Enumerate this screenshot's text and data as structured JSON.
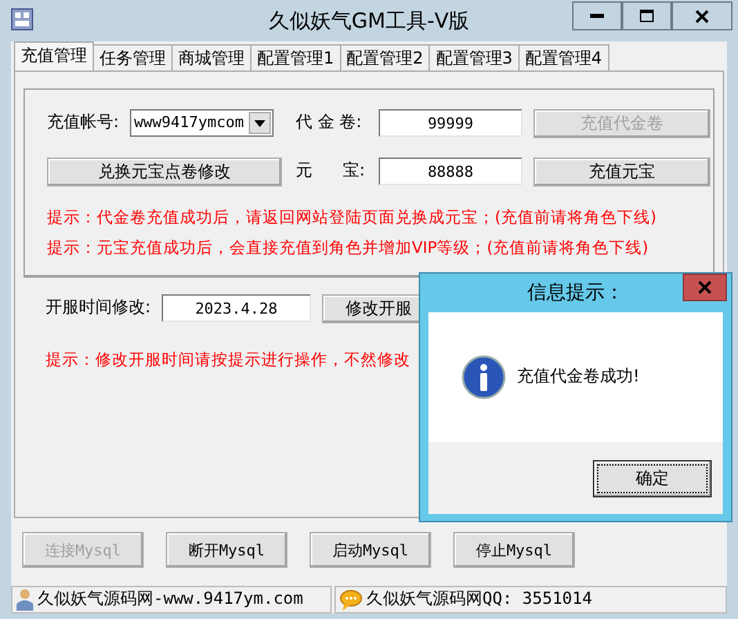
{
  "window": {
    "title": "久似妖气GM工具-V版"
  },
  "tabs": [
    {
      "label": "充值管理",
      "selected": true
    },
    {
      "label": "任务管理",
      "selected": false
    },
    {
      "label": "商城管理",
      "selected": false
    },
    {
      "label": "配置管理1",
      "selected": false
    },
    {
      "label": "配置管理2",
      "selected": false
    },
    {
      "label": "配置管理3",
      "selected": false
    },
    {
      "label": "配置管理4",
      "selected": false
    }
  ],
  "recharge": {
    "account_label": "充值帐号:",
    "account_value": "www9417ymcom",
    "voucher_label": "代 金 卷:",
    "voucher_value": "99999",
    "voucher_button": {
      "label": "充值代金卷",
      "disabled": true
    },
    "exchange_button": {
      "label": "兑换元宝点卷修改",
      "disabled": false
    },
    "ingot_label_1": "元",
    "ingot_label_2": "宝:",
    "ingot_value": "88888",
    "ingot_button": {
      "label": "充值元宝",
      "disabled": false
    },
    "hints": [
      "提示：代金卷充值成功后，请返回网站登陆页面兑换成元宝；(充值前请将角色下线)",
      "提示：元宝充值成功后，会直接充值到角色并增加VIP等级；(充值前请将角色下线)"
    ]
  },
  "server": {
    "label": "开服时间修改:",
    "value": "2023.4.28",
    "button": {
      "label": "修改开服",
      "disabled": false
    },
    "hint": "提示：修改开服时间请按提示进行操作，不然修改"
  },
  "mysql_buttons": [
    {
      "label": "连接Mysql",
      "disabled": true
    },
    {
      "label": "断开Mysql",
      "disabled": false
    },
    {
      "label": "启动Mysql",
      "disabled": false
    },
    {
      "label": "停止Mysql",
      "disabled": false
    }
  ],
  "status_bar": [
    {
      "kind": "user",
      "text": "久似妖气源码网-www.9417ym.com"
    },
    {
      "kind": "chat",
      "text": "久似妖气源码网QQ: 3551014"
    }
  ],
  "dialog": {
    "title": "信息提示：",
    "message": "充值代金卷成功!",
    "button": "确定"
  }
}
